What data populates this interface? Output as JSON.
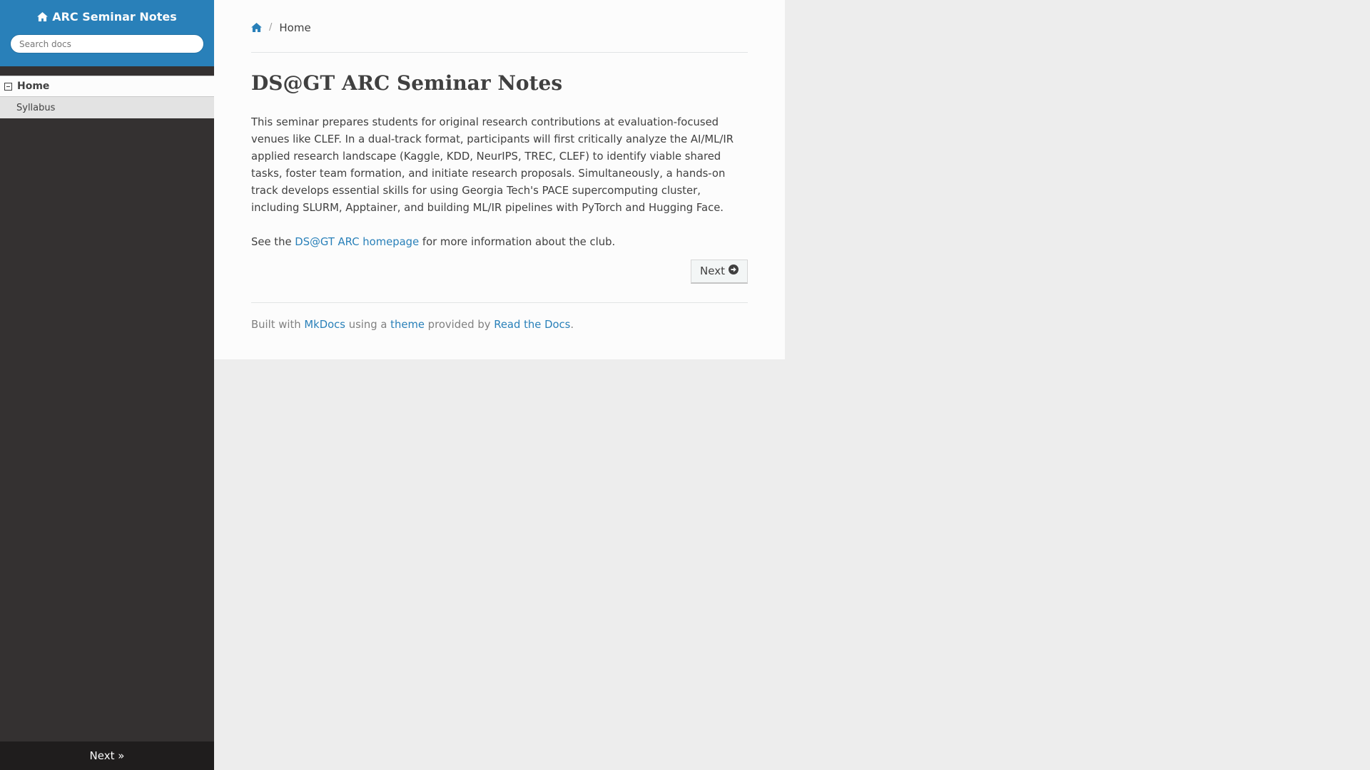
{
  "sidebar": {
    "project_title": "ARC Seminar Notes",
    "search_placeholder": "Search docs",
    "nav_current": "Home",
    "nav_items": [
      {
        "label": "Syllabus"
      }
    ],
    "footer_next": "Next »"
  },
  "breadcrumb": {
    "current": "Home"
  },
  "main": {
    "title": "DS@GT ARC Seminar Notes",
    "paragraph1": "This seminar prepares students for original research contributions at evaluation-focused venues like CLEF. In a dual-track format, participants will first critically analyze the AI/ML/IR applied research landscape (Kaggle, KDD, NeurIPS, TREC, CLEF) to identify viable shared tasks, foster team formation, and initiate research proposals. Simultaneously, a hands-on track develops essential skills for using Georgia Tech's PACE supercomputing cluster, including SLURM, Apptainer, and building ML/IR pipelines with PyTorch and Hugging Face.",
    "paragraph2_prefix": "See the ",
    "paragraph2_link": "DS@GT ARC homepage",
    "paragraph2_suffix": " for more information about the club.",
    "next_button": "Next"
  },
  "footer": {
    "built_with": "Built with ",
    "mkdocs": "MkDocs",
    "using_a": " using a ",
    "theme": "theme",
    "provided_by": " provided by ",
    "rtd": "Read the Docs",
    "period": "."
  },
  "colors": {
    "accent": "#2980b9",
    "sidebar_bg": "#343131",
    "content_bg": "#fcfcfc",
    "page_bg": "#ededed"
  },
  "icons": {
    "home": "home-icon",
    "collapse": "collapse-minus-icon",
    "next": "arrow-circle-right-icon"
  }
}
